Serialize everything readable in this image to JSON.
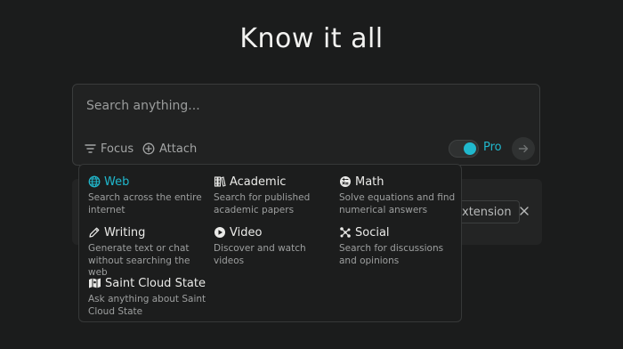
{
  "page": {
    "title": "Know it all"
  },
  "search": {
    "placeholder": "Search anything...",
    "focus_label": "Focus",
    "attach_label": "Attach",
    "pro_label": "Pro",
    "pro_enabled": true
  },
  "background": {
    "extension_label": "xtension"
  },
  "focus_menu": {
    "options": [
      {
        "id": "web",
        "label": "Web",
        "description": "Search across the entire internet",
        "icon": "globe-icon",
        "active": true
      },
      {
        "id": "academic",
        "label": "Academic",
        "description": "Search for published academic papers",
        "icon": "books-icon",
        "active": false
      },
      {
        "id": "math",
        "label": "Math",
        "description": "Solve equations and find numerical answers",
        "icon": "math-icon",
        "active": false
      },
      {
        "id": "writing",
        "label": "Writing",
        "description": "Generate text or chat without searching the web",
        "icon": "pencil-icon",
        "active": false
      },
      {
        "id": "video",
        "label": "Video",
        "description": "Discover and watch videos",
        "icon": "play-icon",
        "active": false
      },
      {
        "id": "social",
        "label": "Social",
        "description": "Search for discussions and opinions",
        "icon": "network-icon",
        "active": false
      },
      {
        "id": "saint-cloud-state",
        "label": "Saint Cloud State",
        "description": "Ask anything about Saint Cloud State",
        "icon": "map-icon",
        "active": false
      }
    ]
  },
  "colors": {
    "accent": "#20b8cd",
    "background": "#1b1c1c",
    "text_muted": "#9d9f9f"
  }
}
